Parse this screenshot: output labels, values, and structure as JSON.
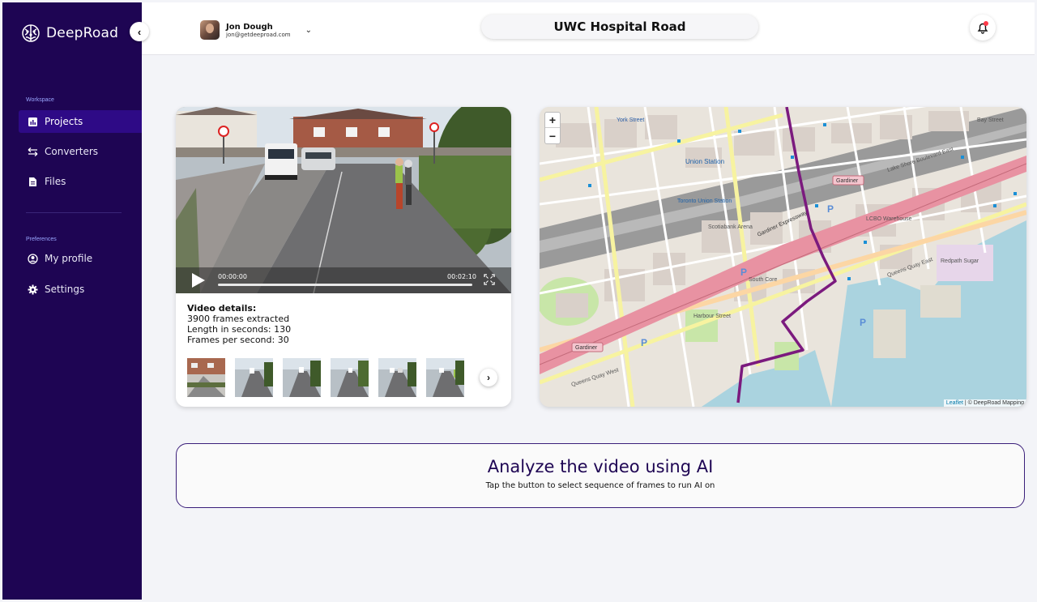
{
  "sidebar": {
    "brand": "DeepRoad",
    "workspace_label": "Workspace",
    "items": [
      {
        "label": "Projects",
        "icon": "chart-icon"
      },
      {
        "label": "Converters",
        "icon": "arrows-icon"
      },
      {
        "label": "Files",
        "icon": "file-icon"
      }
    ],
    "preferences_label": "Preferences",
    "pref_items": [
      {
        "label": "My profile",
        "icon": "user-circle-icon"
      },
      {
        "label": "Settings",
        "icon": "gear-icon"
      }
    ]
  },
  "header": {
    "user_name": "Jon Dough",
    "user_email": "jon@getdeeproad.com",
    "title": "UWC Hospital Road"
  },
  "video": {
    "current_time": "00:00:00",
    "duration": "00:02:10",
    "progress": 0,
    "details_title": "Video details:",
    "frames_extracted": "3900 frames extracted",
    "length": "Length in seconds: 130",
    "fps": "Frames per second: 30"
  },
  "map": {
    "attribution_link": "Leaflet",
    "attribution_text": " | © DeepRoad Mapping",
    "labels": {
      "union_station": "Union Station",
      "toronto_union": "Toronto Union Station",
      "gardiner_expressway": "Gardiner Expressway",
      "gardiner_1": "Gardiner",
      "gardiner_2": "Gardiner",
      "lake_shore": "Lake Shore Boulevard East",
      "queens_quay_east": "Queens Quay East",
      "queens_quay_west": "Queens Quay West",
      "scotiabank": "Scotiabank Arena",
      "redpath": "Redpath Sugar",
      "lcbo": "LCBO Warehouse",
      "york_street": "York Street",
      "bay_street": "Bay Street",
      "harbour_street": "Harbour Street",
      "south_core": "South Core",
      "york_street_2": "York Street"
    }
  },
  "analyze": {
    "title": "Analyze the video using AI",
    "subtitle": "Tap the button to select sequence of frames to run AI on"
  },
  "colors": {
    "sidebar_bg": "#1e0553",
    "active_item": "#2e0a86",
    "route": "#7b1a7e",
    "notification_dot": "#ff3b4a"
  }
}
